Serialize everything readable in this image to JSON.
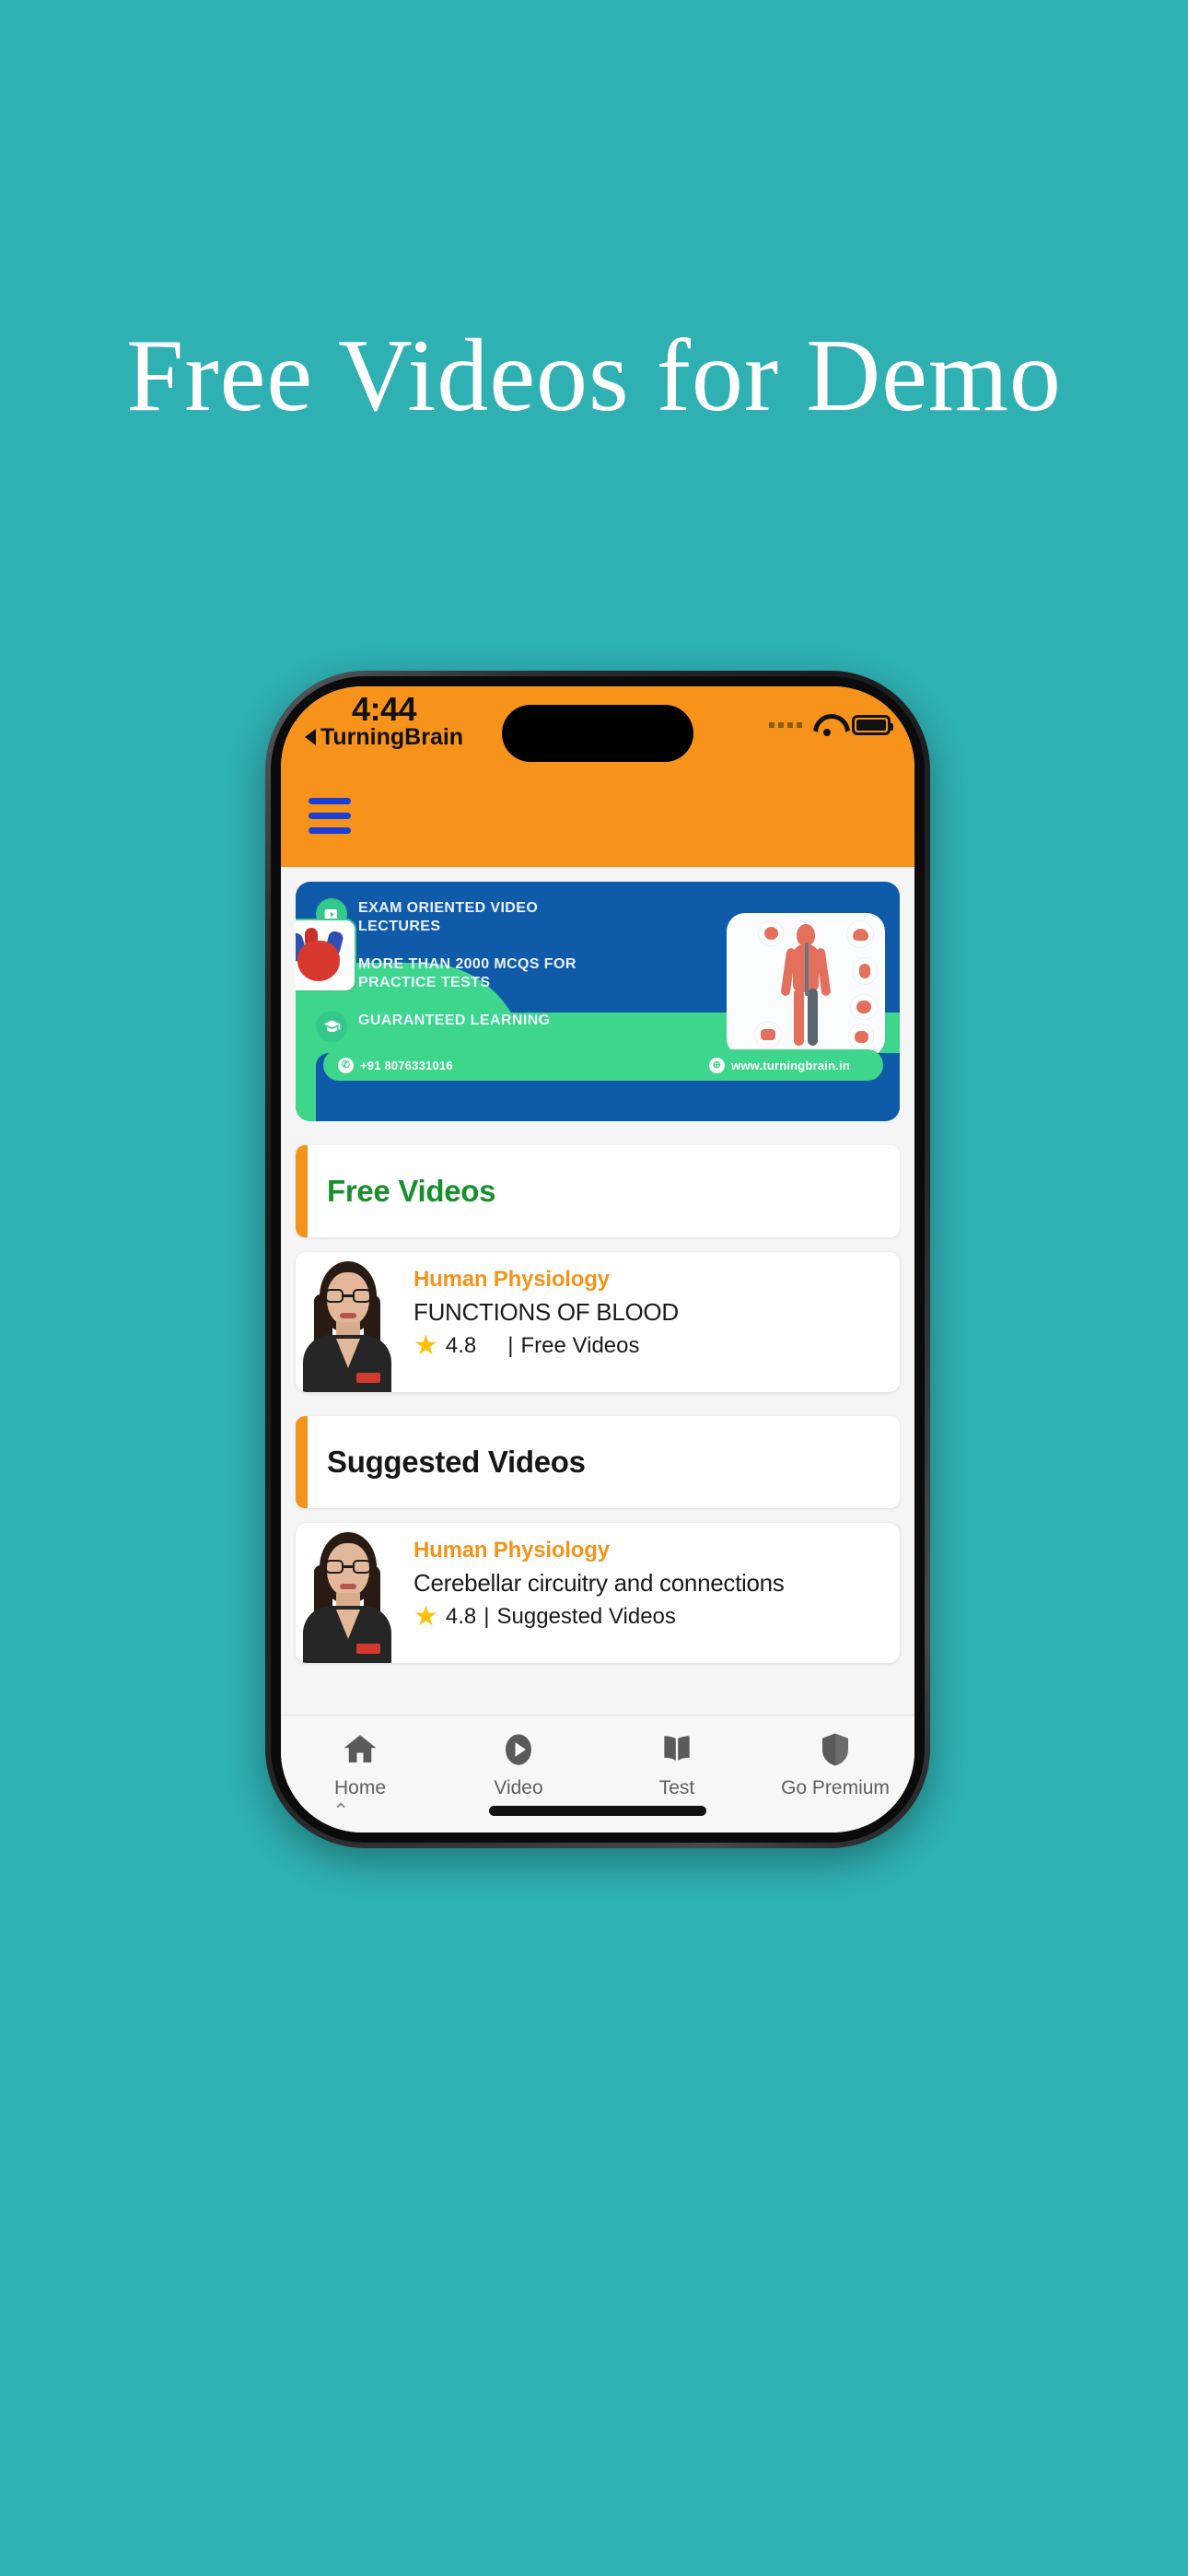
{
  "poster": {
    "headline": "Free Videos for Demo",
    "background_color": "#2FB0B3",
    "headline_color": "#FFFFFF"
  },
  "status_bar": {
    "time": "4:44",
    "back_app_label": "TurningBrain",
    "back_caret_icon": "back-caret-icon",
    "signal_icon": "signal-dots-icon",
    "wifi_icon": "wifi-icon",
    "battery_icon": "battery-full-icon"
  },
  "app_header": {
    "menu_icon": "hamburger-menu-icon",
    "background_color": "#F7931A",
    "menu_color": "#1A3FD6"
  },
  "promo_banner": {
    "background_color": "#0F5BAA",
    "accent_color": "#3DD68C",
    "features": [
      {
        "icon": "video-lecture-icon",
        "text": "EXAM ORIENTED VIDEO LECTURES"
      },
      {
        "icon": "mcq-list-icon",
        "text": "MORE THAN 2000 MCQS FOR PRACTICE TESTS"
      },
      {
        "icon": "graduation-icon",
        "text": "GUARANTEED LEARNING"
      }
    ],
    "contact": {
      "phone_icon": "phone-icon",
      "phone": "+91 8076331016",
      "web_icon": "globe-icon",
      "website": "www.turningbrain.in"
    },
    "artwork_label": "human-anatomy-illustration"
  },
  "sections": [
    {
      "title": "Free Videos",
      "title_color": "#17902B",
      "accent_color": "#F2941C",
      "video": {
        "category": "Human Physiology",
        "title": "FUNCTIONS OF BLOOD",
        "rating": "4.8",
        "separator": "|",
        "tag": "Free Videos",
        "star_icon": "star-icon",
        "thumbnail": "instructor-thumbnail"
      }
    },
    {
      "title": "Suggested Videos",
      "title_color": "#161616",
      "accent_color": "#F2941C",
      "video": {
        "category": "Human Physiology",
        "title": "Cerebellar circuitry and connections",
        "rating": "4.8",
        "separator": "|",
        "tag": "Suggested Videos",
        "star_icon": "star-icon",
        "thumbnail": "instructor-thumbnail"
      }
    }
  ],
  "bottom_nav": {
    "items": [
      {
        "label": "Home",
        "icon": "home-icon"
      },
      {
        "label": "Video",
        "icon": "play-circle-icon"
      },
      {
        "label": "Test",
        "icon": "book-icon"
      },
      {
        "label": "Go Premium",
        "icon": "shield-icon"
      }
    ]
  }
}
